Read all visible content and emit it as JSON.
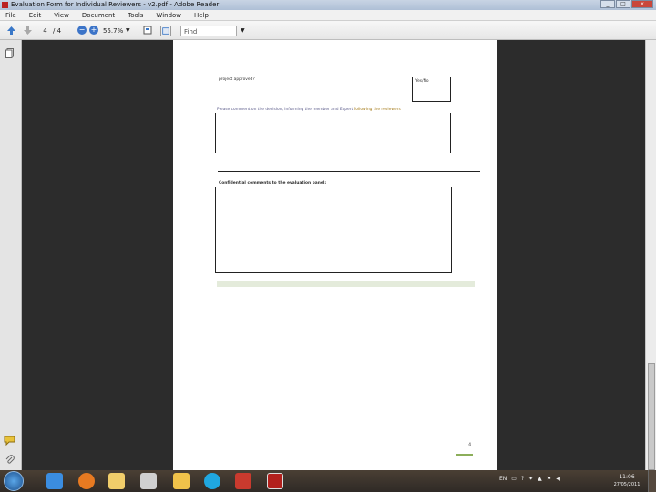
{
  "window": {
    "title": "Evaluation Form for Individual Reviewers - v2.pdf - Adobe Reader",
    "buttons": {
      "minimize": "_",
      "maximize": "□",
      "close": "x"
    }
  },
  "menu": [
    "File",
    "Edit",
    "View",
    "Document",
    "Tools",
    "Window",
    "Help"
  ],
  "toolbar": {
    "current_page": "4",
    "total_pages": "/ 4",
    "zoom": "55.7%",
    "find_placeholder": "Find"
  },
  "document": {
    "q_project_approved": "project approved?",
    "project_approved_value": "Yes/No",
    "q_comments_intro": "Please comment on the decision, informing the member and Expert",
    "q_comments_highlight": " following the reviewers",
    "q_confidential": "Confidential comments to the evaluation panel:",
    "page_footer_number": "4"
  },
  "taskbar": {
    "language": "EN",
    "time": "11:06",
    "date": "27/05/2011"
  },
  "colors": {
    "highlight_text": "#a57b1a",
    "green_bar": "#e4ebdb",
    "footer_rule": "#8cae5a"
  }
}
